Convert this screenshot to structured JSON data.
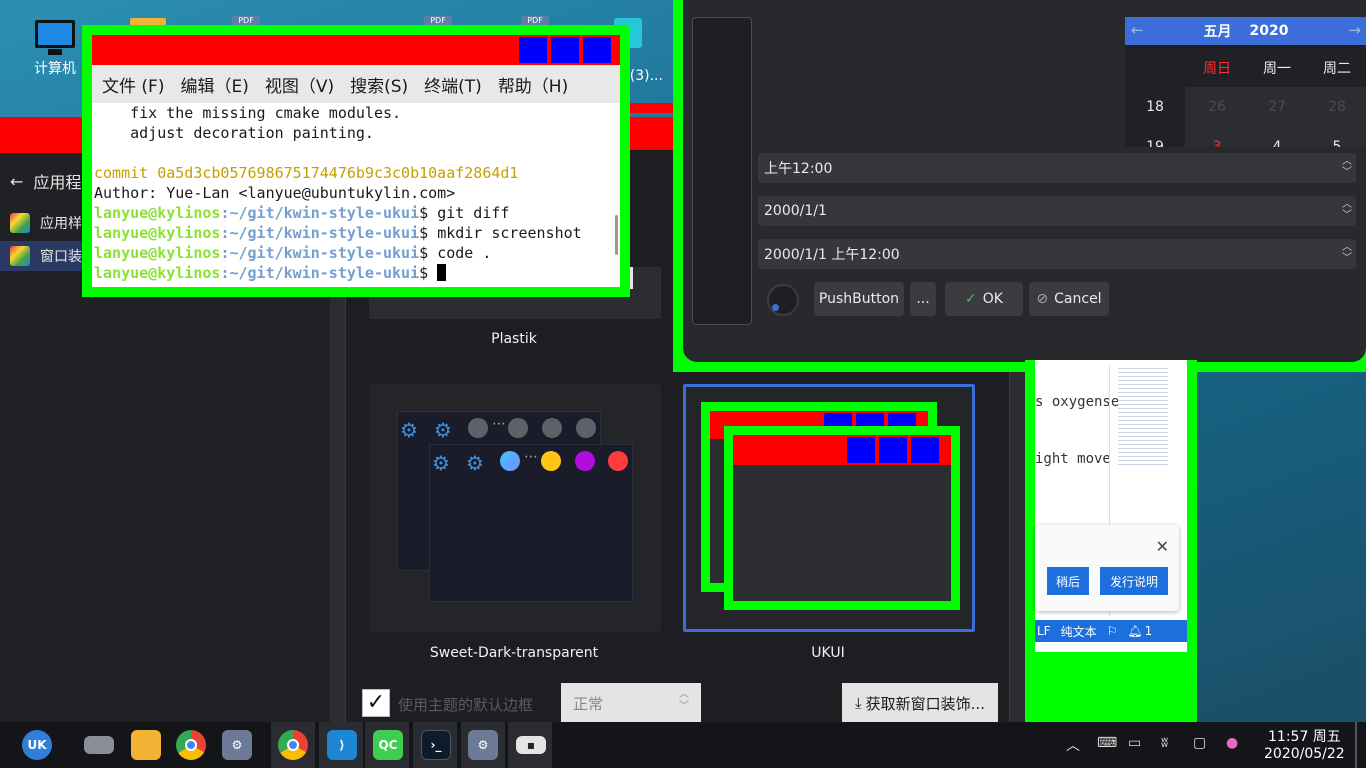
{
  "desktop": {
    "icons": [
      {
        "label": "计算机"
      },
      {
        "label": "ng(3)..."
      }
    ],
    "pdf_badge": "PDF"
  },
  "settings": {
    "sidebar_back": "应用程",
    "sidebar_items": [
      {
        "label": "应用样"
      },
      {
        "label": "窗口装"
      }
    ],
    "themes": [
      {
        "label": "Plastik"
      },
      {
        "label": "Sweet-Dark-transparent"
      },
      {
        "label": "UKUI"
      }
    ],
    "bottom": {
      "checkbox_label": "使用主题的默认边框",
      "size_select": "正常",
      "get_new": "获取新窗口装饰..."
    }
  },
  "terminal": {
    "menu": [
      "文件 (F)",
      "编辑（E)",
      "视图（V)",
      "搜索(S)",
      "终端(T)",
      "帮助（H)"
    ],
    "lines": [
      {
        "text": "    fix the missing cmake modules."
      },
      {
        "text": "    adjust decoration painting."
      },
      {
        "text": ""
      }
    ],
    "commit": "commit 0a5d3cb057698675174476b9c3c0b10aaf2864d1",
    "author": "Author: Yue-Lan <lanyue@ubuntukylin.com>",
    "prompt_user": "lanyue@kylinos",
    "prompt_path": ":~/git/kwin-style-ukui",
    "prompt_symbol": "$ ",
    "commands": [
      "git diff",
      "mkdir screenshot",
      "code ."
    ]
  },
  "widgets": {
    "calendar": {
      "month": "五月",
      "year": "2020",
      "weekdays": [
        "周日",
        "周一",
        "周二"
      ],
      "week_num_1": "18",
      "row1": [
        "26",
        "27",
        "28"
      ],
      "week_num_2": "19",
      "row2": [
        "3",
        "4",
        "5"
      ]
    },
    "time_field": "上午12:00",
    "date_field": "2000/1/1",
    "datetime_field": "2000/1/1 上午12:00",
    "push_button": "PushButton",
    "ellipsis_button": "...",
    "ok_button": "OK",
    "cancel_button": "Cancel"
  },
  "editor": {
    "text1": "s oxygense",
    "text2": "ight move",
    "status": [
      "LF",
      "纯文本",
      "1"
    ],
    "notify_later": "稍后",
    "notify_release": "发行说明"
  },
  "taskbar": {
    "time": "11:57 周五",
    "date": "2020/05/22",
    "qc_label": "QC"
  },
  "colors": {
    "accent": "#3b6ed8",
    "titlebar_red": "#ff0000",
    "frame_green": "#00ff00",
    "button_blue": "#0000ff"
  }
}
